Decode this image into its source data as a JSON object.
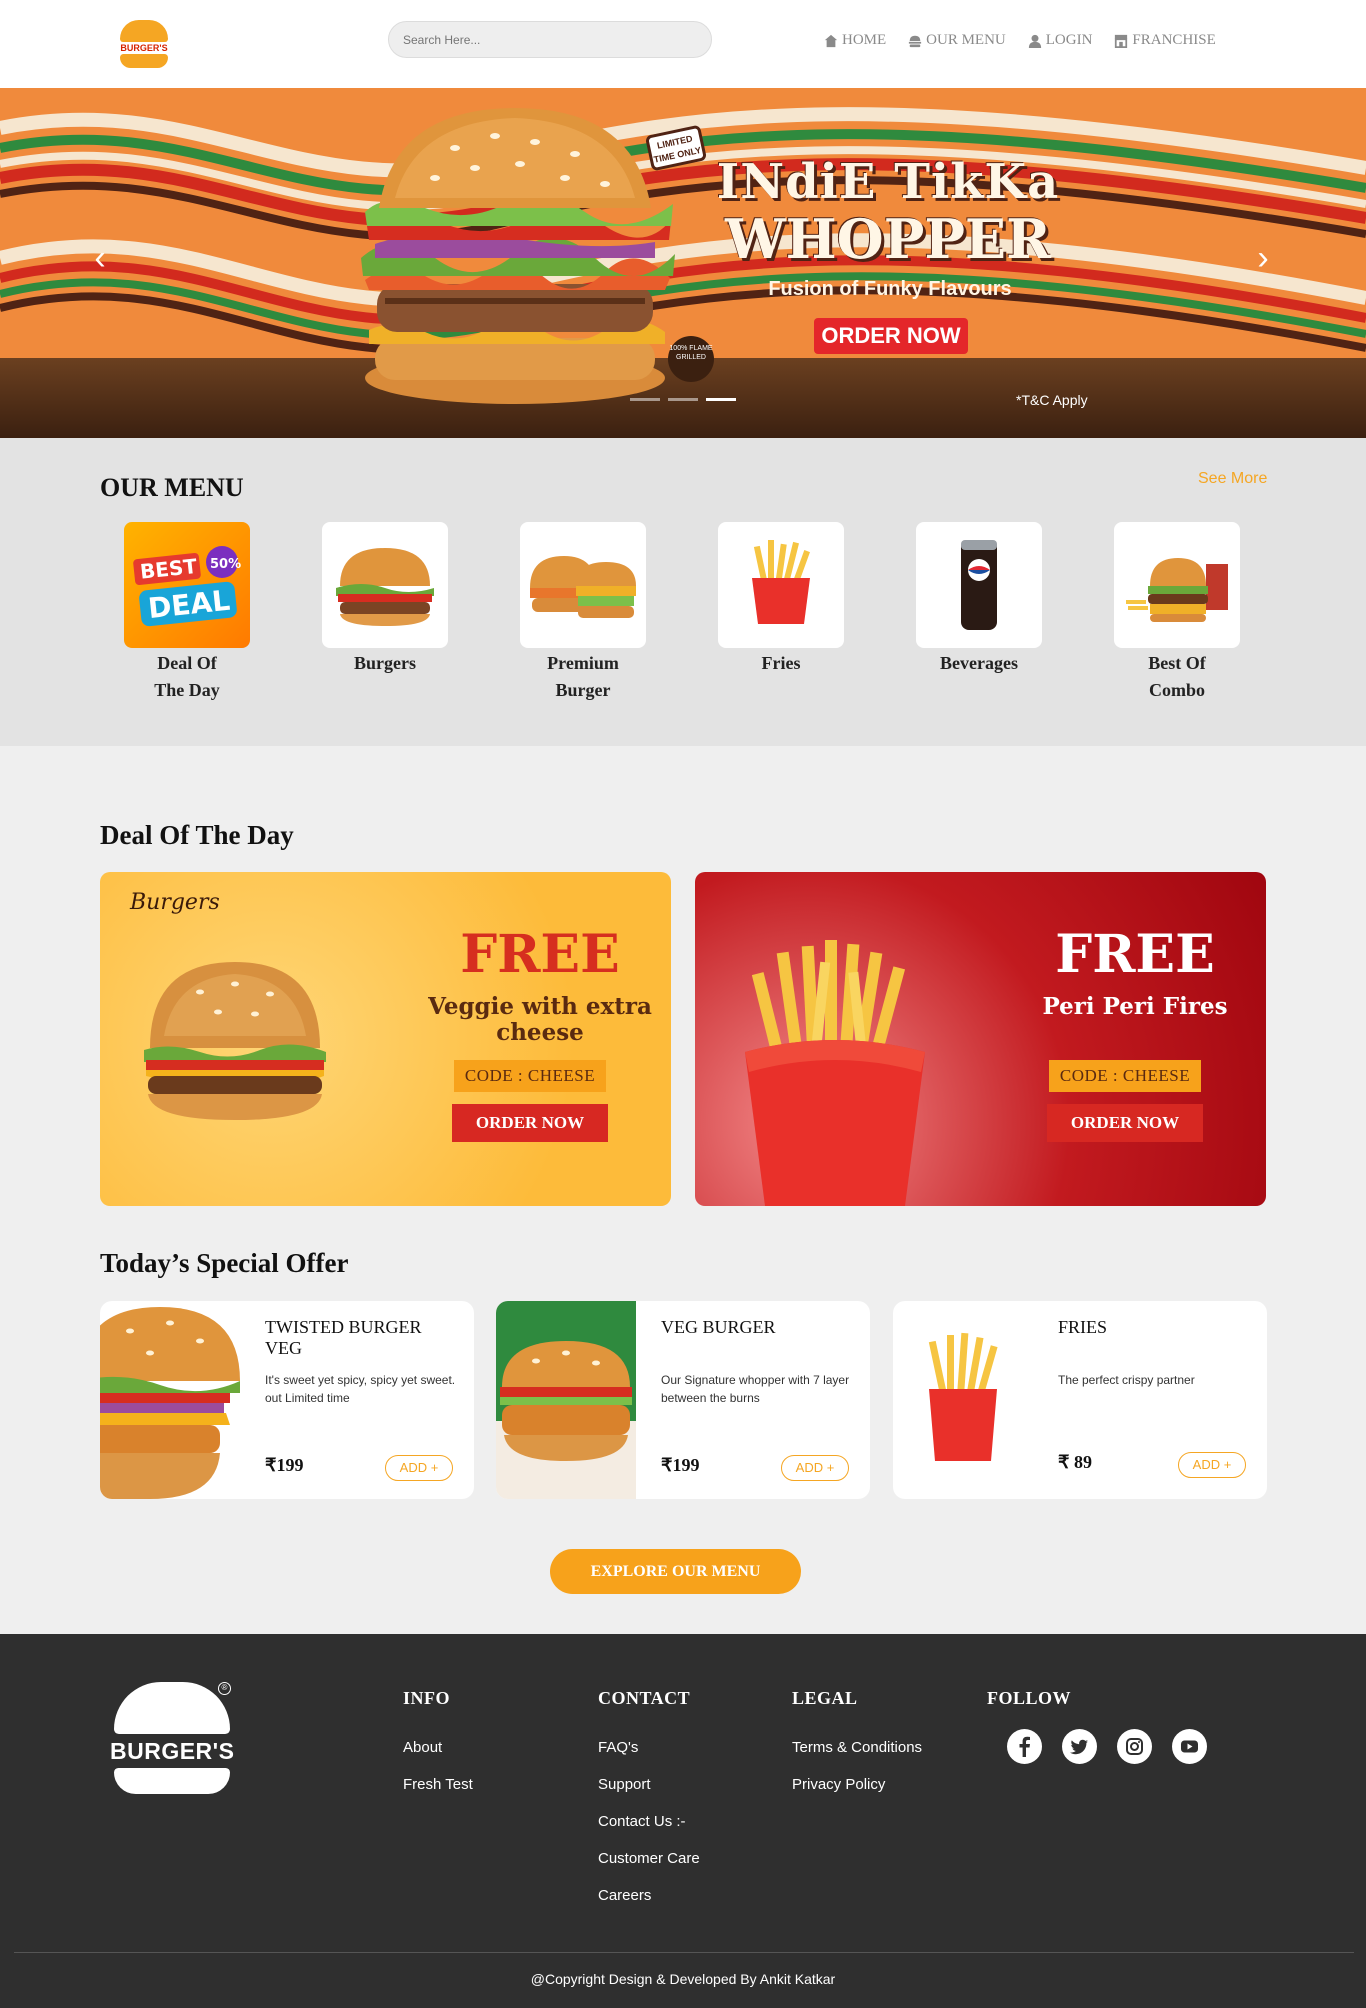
{
  "brand": {
    "logo_text": "BURGER'S",
    "registered": "®",
    "script_name": "Burgers"
  },
  "nav": {
    "search_placeholder": "Search Here...",
    "links": [
      {
        "label": "HOME",
        "icon": "home-icon"
      },
      {
        "label": "OUR MENU",
        "icon": "burger-icon"
      },
      {
        "label": "LOGIN",
        "icon": "user-icon"
      },
      {
        "label": "FRANCHISE",
        "icon": "store-icon"
      }
    ]
  },
  "hero": {
    "badge": "LIMITED TIME ONLY",
    "title_line1": "INdiE TikKa",
    "title_line2": "WHOPPER",
    "subtitle": "Fusion of Funky Flavours",
    "button": "ORDER NOW",
    "grilled_badge": "100% FLAME GRILLED",
    "terms": "*T&C Apply",
    "slides": 3,
    "active_slide": 2
  },
  "menu": {
    "heading": "OUR MENU",
    "see_more": "See More",
    "categories": [
      {
        "label": "Deal Of The Day",
        "art": "best-deal-badge",
        "art_text": [
          "BEST",
          "DEAL",
          "50%"
        ]
      },
      {
        "label": "Burgers",
        "art": "burger-image"
      },
      {
        "label": "Premium Burger",
        "art": "premium-burger-image"
      },
      {
        "label": "Fries",
        "art": "fries-image"
      },
      {
        "label": "Beverages",
        "art": "pepsi-can-image"
      },
      {
        "label": "Best Of Combo",
        "art": "combo-image"
      }
    ]
  },
  "deals": {
    "heading": "Deal Of The Day",
    "items": [
      {
        "free": "FREE",
        "desc": "Veggie with extra cheese",
        "code": "CODE : CHEESE",
        "button": "ORDER NOW"
      },
      {
        "free": "FREE",
        "desc": "Peri Peri Fires",
        "code": "CODE : CHEESE",
        "button": "ORDER NOW"
      }
    ]
  },
  "specials": {
    "heading": "Today’s Special Offer",
    "items": [
      {
        "name": "TWISTED BURGER VEG",
        "desc": "It's sweet yet spicy, spicy yet sweet. out Limited time",
        "price": "₹199",
        "button": "ADD +"
      },
      {
        "name": "VEG BURGER",
        "desc": "Our Signature whopper with 7 layer between the burns",
        "price": "₹199",
        "button": "ADD +"
      },
      {
        "name": "FRIES",
        "desc": "The perfect crispy partner",
        "price": "₹ 89",
        "button": "ADD +"
      }
    ],
    "explore_button": "EXPLORE OUR MENU"
  },
  "footer": {
    "info": {
      "title": "INFO",
      "links": [
        "About",
        "Fresh Test"
      ]
    },
    "contact": {
      "title": "CONTACT",
      "links": [
        "FAQ's",
        "Support",
        "Contact Us :-",
        "Customer Care",
        "Careers"
      ]
    },
    "legal": {
      "title": "LEGAL",
      "links": [
        "Terms & Conditions",
        "Privacy Policy"
      ]
    },
    "follow": {
      "title": "FOLLOW",
      "icons": [
        "facebook-icon",
        "twitter-icon",
        "instagram-icon",
        "youtube-icon"
      ]
    },
    "copyright": "@Copyright Design & Developed By Ankit Katkar"
  },
  "colors": {
    "accent": "#f7a21b",
    "red": "#d72822",
    "footer": "#2f2f2f",
    "hero": "#f08a3c"
  }
}
